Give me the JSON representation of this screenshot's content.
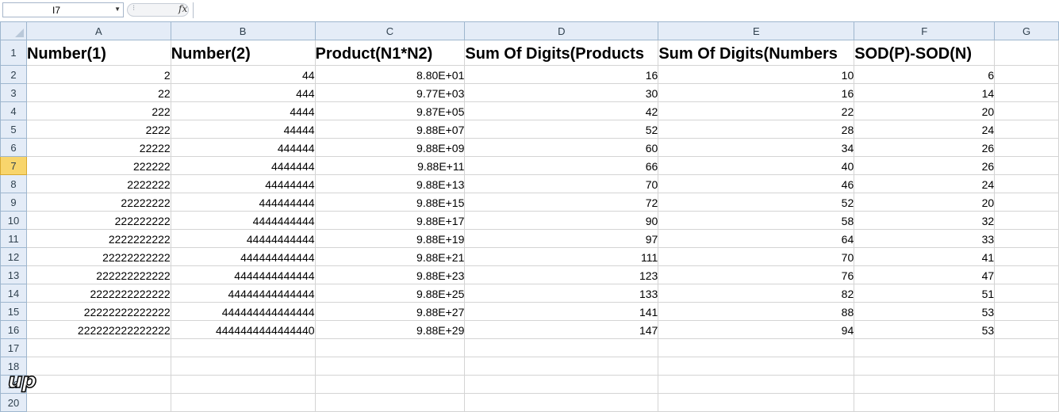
{
  "formula_bar": {
    "name_box": "I7",
    "fx_label": "fx",
    "formula": ""
  },
  "columns": [
    "A",
    "B",
    "C",
    "D",
    "E",
    "F",
    "G"
  ],
  "header_row": [
    "Number(1)",
    "Number(2)",
    "Product(N1*N2)",
    "Sum Of Digits(Products",
    "Sum Of Digits(Numbers",
    "SOD(P)-SOD(N)",
    ""
  ],
  "active_row": "7",
  "rows": [
    {
      "n": "2",
      "cells": [
        "2",
        "44",
        "8.80E+01",
        "16",
        "10",
        "6",
        ""
      ]
    },
    {
      "n": "3",
      "cells": [
        "22",
        "444",
        "9.77E+03",
        "30",
        "16",
        "14",
        ""
      ]
    },
    {
      "n": "4",
      "cells": [
        "222",
        "4444",
        "9.87E+05",
        "42",
        "22",
        "20",
        ""
      ]
    },
    {
      "n": "5",
      "cells": [
        "2222",
        "44444",
        "9.88E+07",
        "52",
        "28",
        "24",
        ""
      ]
    },
    {
      "n": "6",
      "cells": [
        "22222",
        "444444",
        "9.88E+09",
        "60",
        "34",
        "26",
        ""
      ]
    },
    {
      "n": "7",
      "cells": [
        "222222",
        "4444444",
        "9.88E+11",
        "66",
        "40",
        "26",
        ""
      ]
    },
    {
      "n": "8",
      "cells": [
        "2222222",
        "44444444",
        "9.88E+13",
        "70",
        "46",
        "24",
        ""
      ]
    },
    {
      "n": "9",
      "cells": [
        "22222222",
        "444444444",
        "9.88E+15",
        "72",
        "52",
        "20",
        ""
      ]
    },
    {
      "n": "10",
      "cells": [
        "222222222",
        "4444444444",
        "9.88E+17",
        "90",
        "58",
        "32",
        ""
      ]
    },
    {
      "n": "11",
      "cells": [
        "2222222222",
        "44444444444",
        "9.88E+19",
        "97",
        "64",
        "33",
        ""
      ]
    },
    {
      "n": "12",
      "cells": [
        "22222222222",
        "444444444444",
        "9.88E+21",
        "111",
        "70",
        "41",
        ""
      ]
    },
    {
      "n": "13",
      "cells": [
        "222222222222",
        "4444444444444",
        "9.88E+23",
        "123",
        "76",
        "47",
        ""
      ]
    },
    {
      "n": "14",
      "cells": [
        "2222222222222",
        "44444444444444",
        "9.88E+25",
        "133",
        "82",
        "51",
        ""
      ]
    },
    {
      "n": "15",
      "cells": [
        "22222222222222",
        "444444444444444",
        "9.88E+27",
        "141",
        "88",
        "53",
        ""
      ]
    },
    {
      "n": "16",
      "cells": [
        "222222222222222",
        "4444444444444440",
        "9.88E+29",
        "147",
        "94",
        "53",
        ""
      ]
    },
    {
      "n": "17",
      "cells": [
        "",
        "",
        "",
        "",
        "",
        "",
        ""
      ]
    },
    {
      "n": "18",
      "cells": [
        "",
        "",
        "",
        "",
        "",
        "",
        ""
      ]
    },
    {
      "n": "19",
      "cells": [
        "",
        "",
        "",
        "",
        "",
        "",
        ""
      ]
    },
    {
      "n": "20",
      "cells": [
        "",
        "",
        "",
        "",
        "",
        "",
        ""
      ]
    }
  ],
  "row1_label": "1",
  "logo_text": "up",
  "colors": {
    "header_bg": "#e4ecf7",
    "active_row_bg": "#f8d56c",
    "gridline": "#d4d4d4"
  }
}
